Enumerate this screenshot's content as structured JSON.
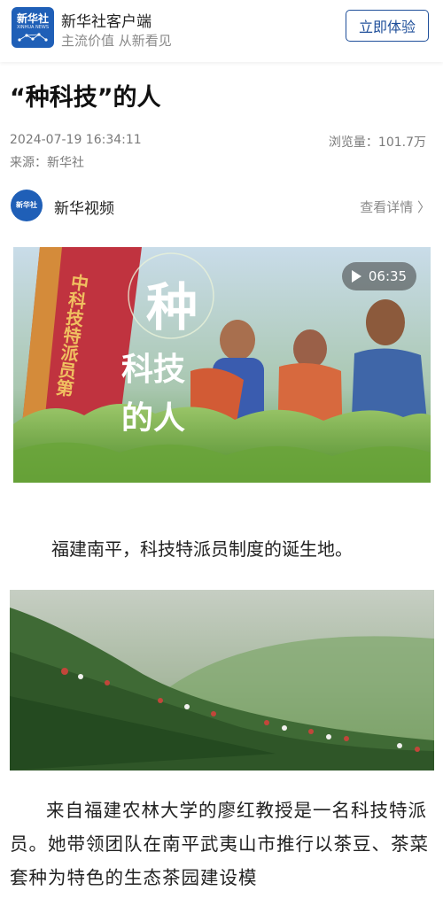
{
  "app": {
    "name": "新华社客户端",
    "slogan": "主流价值 从新看见",
    "logo_text": "新华社",
    "logo_en": "XINHUA NEWS",
    "cta_label": "立即体验"
  },
  "article": {
    "title": "“种科技”的人",
    "datetime": "2024-07-19 16:34:11",
    "views": "浏览量：101.7万",
    "source": "来源：新华社",
    "author": {
      "name": "新华视频",
      "avatar_text": "新华社",
      "details_label": "查看详情 〉"
    },
    "video": {
      "duration": "06:35",
      "overlay_title": [
        "种",
        "科技",
        "的人"
      ],
      "sign_text": "中科技特派员第"
    },
    "paragraphs": [
      "福建南平，科技特派员制度的诞生地。",
      "来自福建农林大学的廖红教授是一名科技特派员。她带领团队在南平武夷山市推行以茶豆、茶菜套种为特色的生态茶园建设模"
    ]
  },
  "colors": {
    "brand_blue": "#1f5fb7",
    "cta_border": "#1f4f9a",
    "meta_gray": "#7a7a7a"
  },
  "icons": {
    "play": "play-icon",
    "chevron": "chevron-right-icon"
  }
}
